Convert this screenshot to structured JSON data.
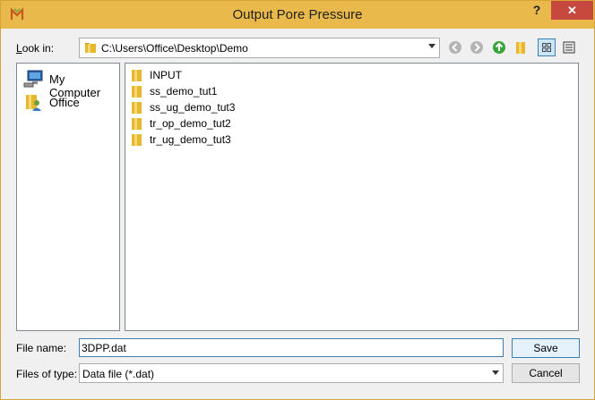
{
  "window": {
    "title": "Output Pore Pressure",
    "help": "?",
    "close": "✕"
  },
  "lookin": {
    "label": "Look in:",
    "path": "C:\\Users\\Office\\Desktop\\Demo"
  },
  "sidebar": {
    "items": [
      {
        "label": "My Computer",
        "icon": "computer-icon"
      },
      {
        "label": "Office",
        "icon": "user-folder-icon"
      }
    ]
  },
  "files": [
    {
      "name": "INPUT"
    },
    {
      "name": "ss_demo_tut1"
    },
    {
      "name": "ss_ug_demo_tut3"
    },
    {
      "name": "tr_op_demo_tut2"
    },
    {
      "name": "tr_ug_demo_tut3"
    }
  ],
  "filename": {
    "label": "File name:",
    "value": "3DPP.dat"
  },
  "filetype": {
    "label": "Files of type:",
    "value": "Data file (*.dat)"
  },
  "buttons": {
    "save": "Save",
    "cancel": "Cancel"
  },
  "colors": {
    "titlebar": "#e9b94b",
    "close": "#c7483f",
    "folder": "#e8b730",
    "accent": "#3c7fb1"
  }
}
